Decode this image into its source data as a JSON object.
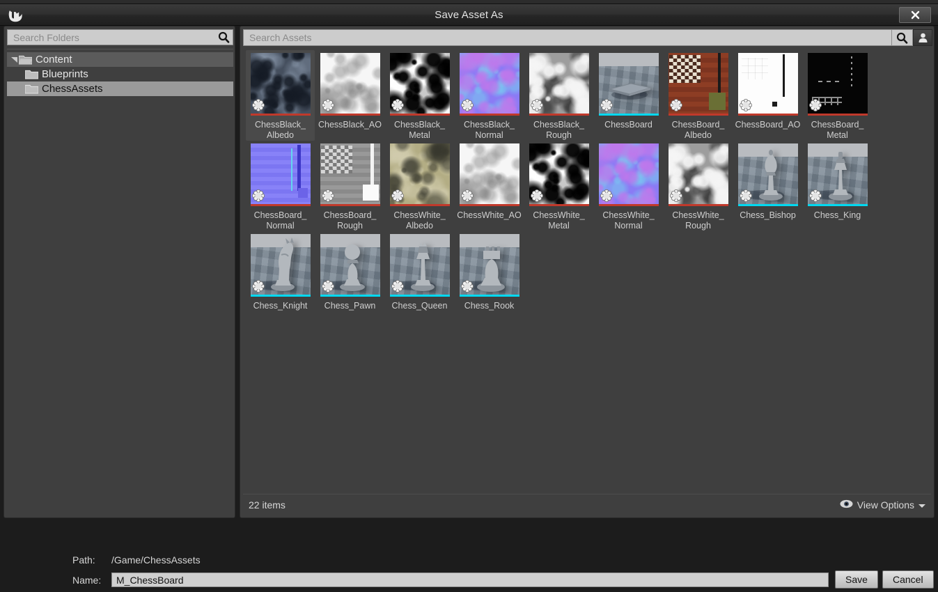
{
  "window": {
    "title": "Save Asset As",
    "close_label": "✕",
    "logo_icon": "unreal-engine-logo"
  },
  "folder_panel": {
    "search": {
      "placeholder": "Search Folders",
      "value": "",
      "icon": "search-icon"
    },
    "tree": [
      {
        "label": "Content",
        "depth": 0,
        "state": "expanded",
        "selected": false,
        "icon": "folder-open-icon"
      },
      {
        "label": "Blueprints",
        "depth": 1,
        "state": "leaf",
        "selected": false,
        "icon": "folder-icon"
      },
      {
        "label": "ChessAssets",
        "depth": 1,
        "state": "leaf",
        "selected": true,
        "icon": "folder-icon"
      }
    ]
  },
  "asset_panel": {
    "search": {
      "placeholder": "Search Assets",
      "value": "",
      "icon": "search-icon"
    },
    "filter_icon": "user-filter-icon",
    "item_count": "22 items",
    "view_options": {
      "label": "View Options",
      "icon": "eye-icon",
      "chevron": "chevron-down-icon"
    },
    "type_colors": {
      "texture": "#c0392b",
      "static_mesh": "#00d8f0"
    },
    "assets": [
      {
        "name": "ChessBlack_Albedo",
        "type": "texture",
        "thumb": "swirl-dark",
        "highlighted": true
      },
      {
        "name": "ChessBlack_AO",
        "type": "texture",
        "thumb": "swirl-white",
        "highlighted": false
      },
      {
        "name": "ChessBlack_Metal",
        "type": "texture",
        "thumb": "swirl-contrast",
        "highlighted": false
      },
      {
        "name": "ChessBlack_Normal",
        "type": "texture",
        "thumb": "swirl-normal",
        "highlighted": false
      },
      {
        "name": "ChessBlack_Rough",
        "type": "texture",
        "thumb": "swirl-gray",
        "highlighted": false
      },
      {
        "name": "ChessBoard",
        "type": "static_mesh",
        "thumb": "mesh-board",
        "highlighted": false
      },
      {
        "name": "ChessBoard_Albedo",
        "type": "texture",
        "thumb": "board-albedo",
        "highlighted": false
      },
      {
        "name": "ChessBoard_AO",
        "type": "texture",
        "thumb": "board-ao",
        "highlighted": false
      },
      {
        "name": "ChessBoard_Metal",
        "type": "texture",
        "thumb": "board-metal",
        "highlighted": false
      },
      {
        "name": "ChessBoard_Normal",
        "type": "texture",
        "thumb": "board-normal",
        "highlighted": false
      },
      {
        "name": "ChessBoard_Rough",
        "type": "texture",
        "thumb": "board-rough",
        "highlighted": false
      },
      {
        "name": "ChessWhite_Albedo",
        "type": "texture",
        "thumb": "swirl-khaki",
        "highlighted": false
      },
      {
        "name": "ChessWhite_AO",
        "type": "texture",
        "thumb": "swirl-white",
        "highlighted": false
      },
      {
        "name": "ChessWhite_Metal",
        "type": "texture",
        "thumb": "swirl-contrast",
        "highlighted": false
      },
      {
        "name": "ChessWhite_Normal",
        "type": "texture",
        "thumb": "swirl-normal",
        "highlighted": false
      },
      {
        "name": "ChessWhite_Rough",
        "type": "texture",
        "thumb": "swirl-gray",
        "highlighted": false
      },
      {
        "name": "Chess_Bishop",
        "type": "static_mesh",
        "thumb": "mesh-bishop",
        "highlighted": false
      },
      {
        "name": "Chess_King",
        "type": "static_mesh",
        "thumb": "mesh-king",
        "highlighted": false
      },
      {
        "name": "Chess_Knight",
        "type": "static_mesh",
        "thumb": "mesh-knight",
        "highlighted": false
      },
      {
        "name": "Chess_Pawn",
        "type": "static_mesh",
        "thumb": "mesh-pawn",
        "highlighted": false
      },
      {
        "name": "Chess_Queen",
        "type": "static_mesh",
        "thumb": "mesh-queen",
        "highlighted": false
      },
      {
        "name": "Chess_Rook",
        "type": "static_mesh",
        "thumb": "mesh-rook",
        "highlighted": false
      }
    ],
    "dirty_icon": "unsaved-asset-icon"
  },
  "footer_form": {
    "path_label": "Path:",
    "path_value": "/Game/ChessAssets",
    "name_label": "Name:",
    "name_value": "M_ChessBoard",
    "save_label": "Save",
    "cancel_label": "Cancel"
  }
}
